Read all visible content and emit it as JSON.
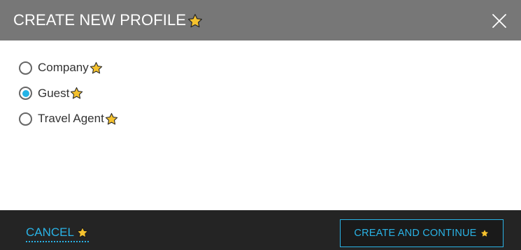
{
  "dialog": {
    "title": "CREATE NEW PROFILE",
    "title_star_icon": "star-icon",
    "close_icon": "close-icon"
  },
  "options": [
    {
      "label": "Company",
      "checked": false,
      "icon": "star-icon"
    },
    {
      "label": "Guest",
      "checked": true,
      "icon": "star-icon"
    },
    {
      "label": "Travel Agent",
      "checked": false,
      "icon": "star-icon"
    }
  ],
  "footer": {
    "cancel_label": "CANCEL",
    "create_label": "CREATE AND CONTINUE"
  },
  "colors": {
    "header_bg": "#777777",
    "footer_bg": "#242424",
    "accent": "#2ab3e6",
    "star_fill": "#f5c22e"
  }
}
